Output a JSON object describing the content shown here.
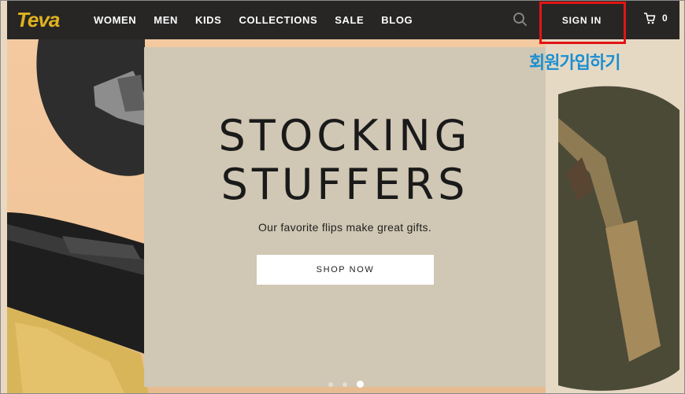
{
  "brand": {
    "logo_text": "Teva",
    "logo_color": "#e0b21f"
  },
  "nav": {
    "items": [
      {
        "label": "WOMEN"
      },
      {
        "label": "MEN"
      },
      {
        "label": "KIDS"
      },
      {
        "label": "COLLECTIONS"
      },
      {
        "label": "SALE"
      },
      {
        "label": "BLOG"
      }
    ],
    "search_icon": "search-icon",
    "signin_label": "SIGN IN",
    "cart_icon": "cart-icon",
    "cart_count": "0"
  },
  "annotation": {
    "text": "회원가입하기",
    "highlight_color": "#e11515",
    "text_color": "#1b8fd1"
  },
  "hero": {
    "headline_line1": "STOCKING",
    "headline_line2": "STUFFERS",
    "subline": "Our favorite flips make great gifts.",
    "cta_label": "SHOP NOW",
    "carousel_slides": 3,
    "carousel_active_slide": 3
  }
}
